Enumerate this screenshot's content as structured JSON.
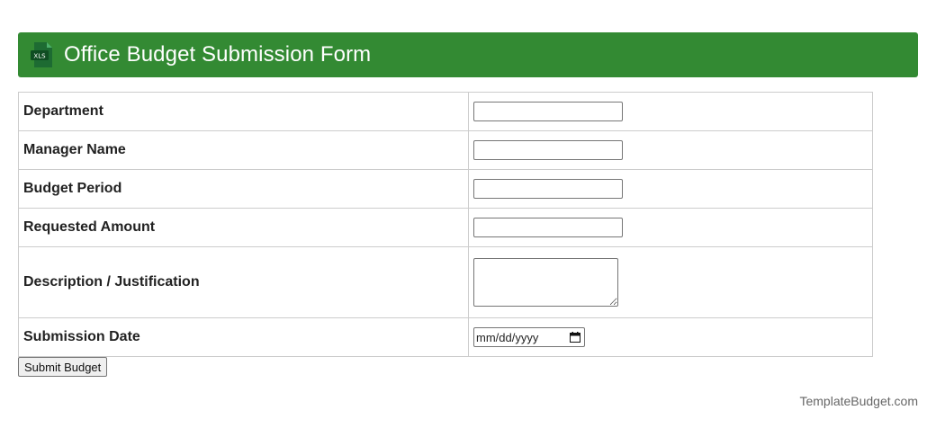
{
  "header": {
    "title": "Office Budget Submission Form",
    "icon": "xls-file-icon",
    "icon_text": "XLS",
    "bar_color": "#338a33"
  },
  "form": {
    "fields": [
      {
        "label": "Department",
        "type": "text",
        "value": ""
      },
      {
        "label": "Manager Name",
        "type": "text",
        "value": ""
      },
      {
        "label": "Budget Period",
        "type": "text",
        "value": ""
      },
      {
        "label": "Requested Amount",
        "type": "text",
        "value": ""
      },
      {
        "label": "Description / Justification",
        "type": "textarea",
        "value": ""
      },
      {
        "label": "Submission Date",
        "type": "date",
        "value": "",
        "placeholder": "mm/dd/yyyy"
      }
    ],
    "submit_label": "Submit Budget"
  },
  "footer": {
    "brand": "TemplateBudget.com"
  }
}
